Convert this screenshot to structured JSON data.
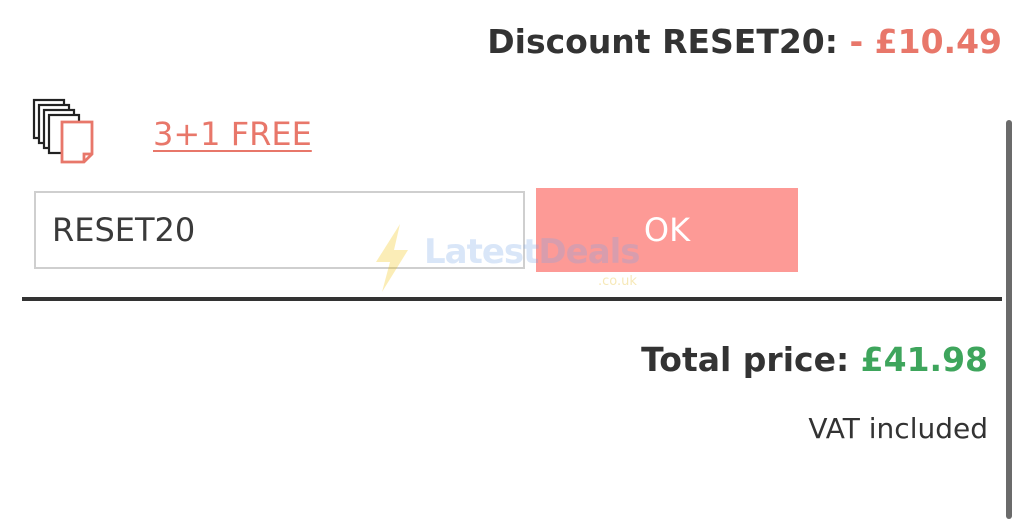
{
  "discount": {
    "label": "Discount RESET20:",
    "value": "- £10.49"
  },
  "promo": {
    "icon": "stacked-documents-icon",
    "link_text": "3+1 FREE"
  },
  "coupon": {
    "input_value": "RESET20",
    "ok_label": "OK"
  },
  "watermark": {
    "text": "LatestDeals",
    "domain": ".co.uk"
  },
  "total": {
    "label": "Total price:",
    "value": "£41.98",
    "vat_note": "VAT included"
  },
  "colors": {
    "accent": "#e8776a",
    "button": "#fd9a96",
    "total": "#3ea55c",
    "text": "#333333"
  }
}
